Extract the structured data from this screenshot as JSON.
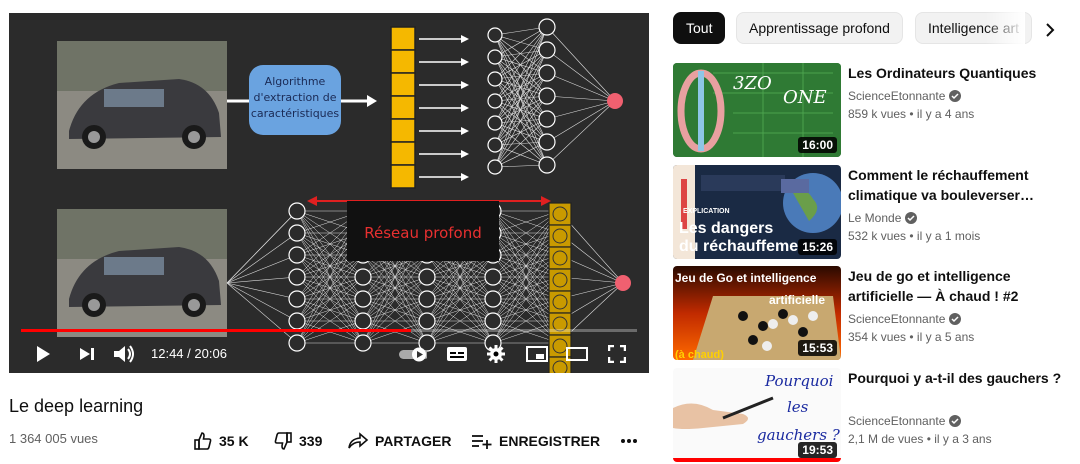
{
  "player": {
    "time_current": "12:44",
    "time_total": "20:06",
    "progress": 0.633,
    "box_label": [
      "Algorithme",
      "d'extraction de",
      "caractéristiques"
    ],
    "deep_label": "Réseau profond"
  },
  "video": {
    "title": "Le deep learning",
    "views": "1 364 005 vues",
    "likes": "35 K",
    "dislikes": "339",
    "share_label": "PARTAGER",
    "save_label": "ENREGISTRER"
  },
  "chips": [
    "Tout",
    "Apprentissage profond",
    "Intelligence art"
  ],
  "recommendations": [
    {
      "title": "Les Ordinateurs Quantiques",
      "channel": "ScienceEtonnante",
      "meta": "859 k vues • il y a 4 ans",
      "duration": "16:00"
    },
    {
      "title": "Comment le réchauffement climatique va bouleverser…",
      "channel": "Le Monde",
      "meta": "532 k vues • il y a 1 mois",
      "duration": "15:26",
      "thumb_label1": "Les dangers",
      "thumb_label2": "du réchauffeme",
      "thumb_tag": "EXPLICATION"
    },
    {
      "title": "Jeu de go et intelligence artificielle — À chaud ! #2",
      "channel": "ScienceEtonnante",
      "meta": "354 k vues • il y a 5 ans",
      "duration": "15:53",
      "thumb_label1": "Jeu de Go et intelligence",
      "thumb_label2": "artificielle",
      "thumb_label3": "(à chaud)"
    },
    {
      "title": "Pourquoi y a-t-il des gauchers ?",
      "channel": "ScienceEtonnante",
      "meta": "2,1 M de vues • il y a 3 ans",
      "duration": "19:53",
      "thumb_label1": "Pourquoi",
      "thumb_label2": "les",
      "thumb_label3": "gauchers ?"
    }
  ],
  "colors": {
    "accent": "#ff0000",
    "node_red": "#f06070",
    "feature_yellow": "#f5b800"
  }
}
